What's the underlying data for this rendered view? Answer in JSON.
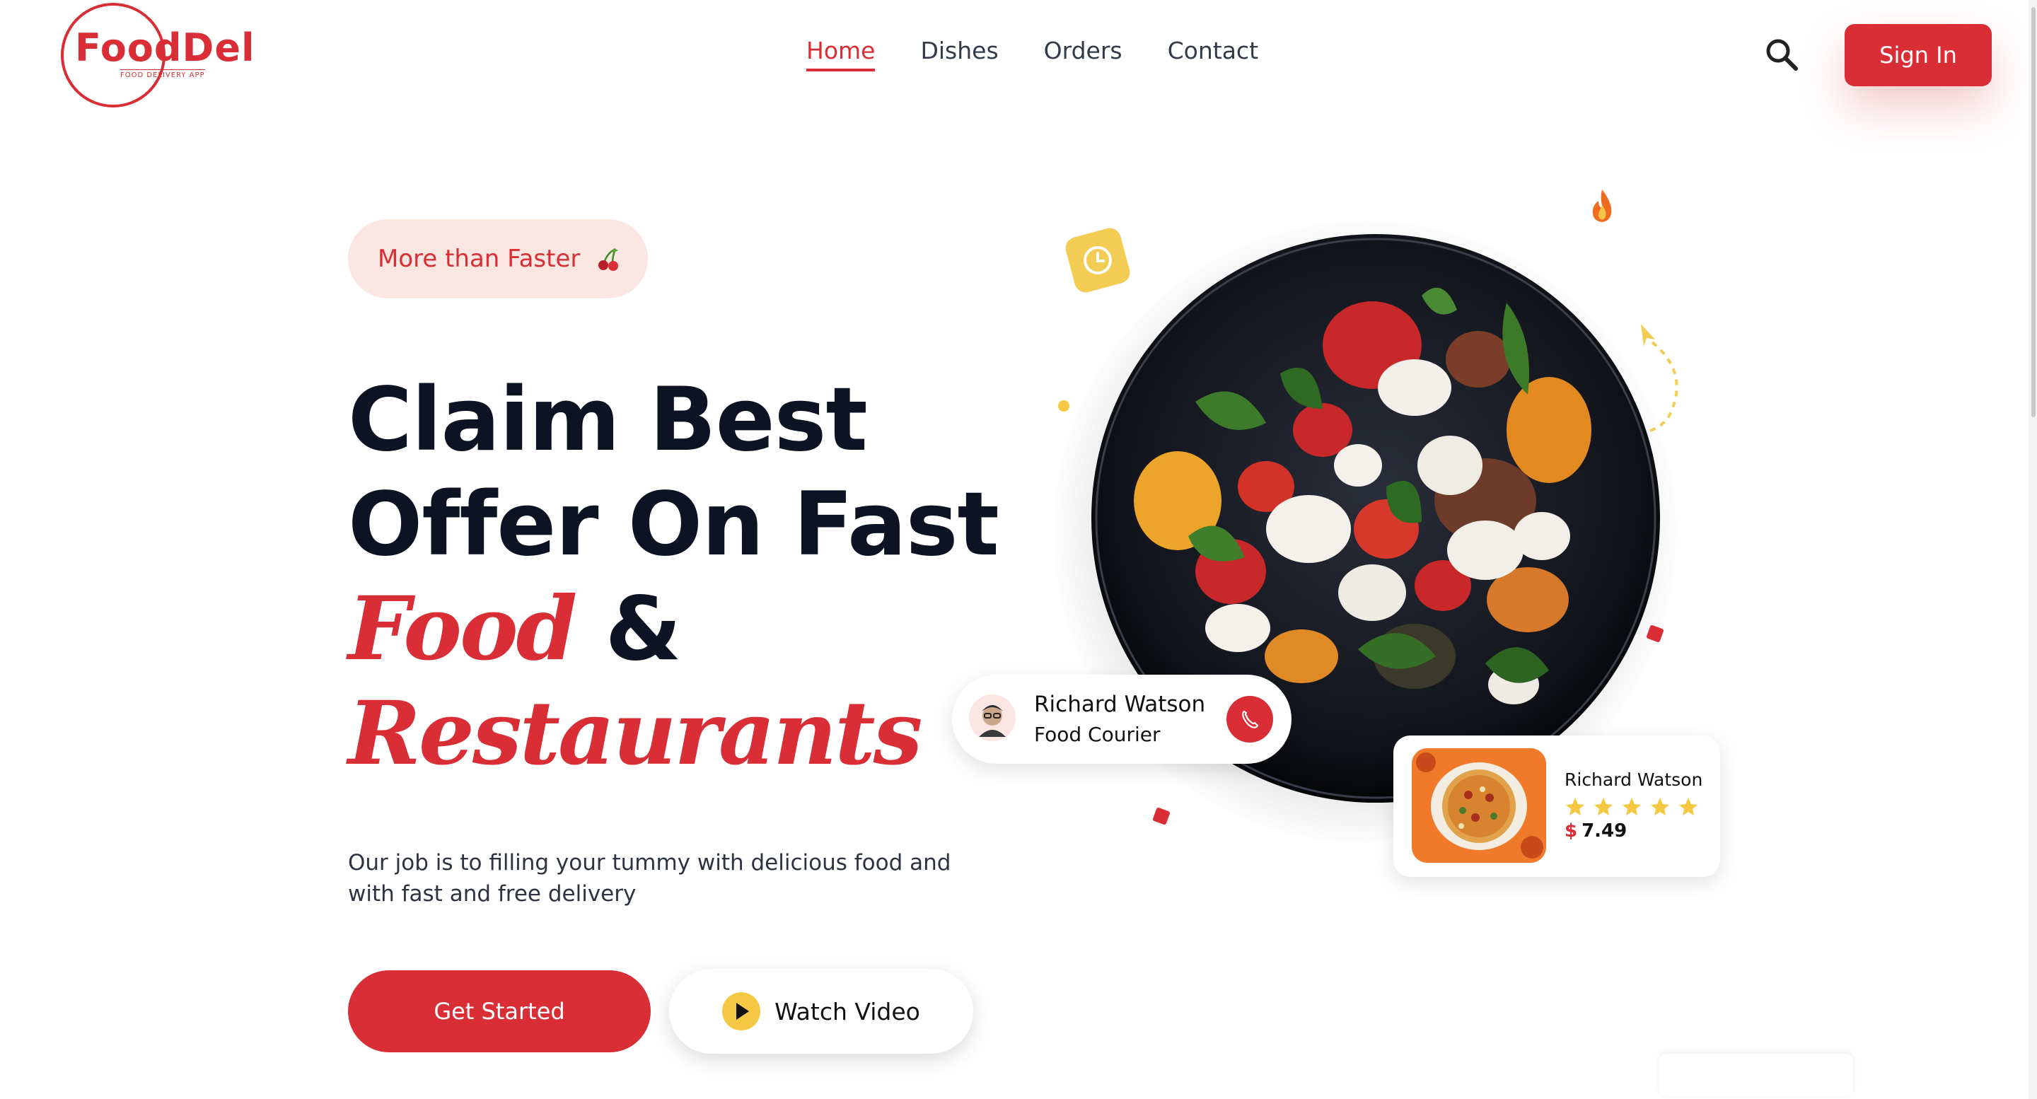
{
  "header": {
    "logo": {
      "name": "FoodDel",
      "tagline": "FOOD DELIVERY APP"
    },
    "nav": [
      {
        "label": "Home",
        "active": true
      },
      {
        "label": "Dishes",
        "active": false
      },
      {
        "label": "Orders",
        "active": false
      },
      {
        "label": "Contact",
        "active": false
      }
    ],
    "search_icon": "search-icon",
    "signin_label": "Sign In"
  },
  "hero": {
    "badge": {
      "text": "More than Faster",
      "icon": "cherry-icon"
    },
    "headline": {
      "line1": "Claim Best",
      "line2": "Offer On Fast",
      "food": "Food",
      "amp": "&",
      "restaurants": "Restaurants"
    },
    "description": "Our job is to filling your tummy with delicious food and\n with fast and free delivery",
    "cta_primary": "Get Started",
    "cta_secondary": "Watch Video"
  },
  "courier_card": {
    "name": "Richard Watson",
    "role": "Food Courier",
    "icon": "phone-icon"
  },
  "product_card": {
    "name": "Richard Watson",
    "rating": 5,
    "max_rating": 5,
    "currency": "$",
    "price": "7.49"
  },
  "colors": {
    "brand": "#d92e36",
    "accent_yellow": "#f5c844",
    "badge_bg": "#fbe6e2",
    "heading": "#0c1322"
  }
}
